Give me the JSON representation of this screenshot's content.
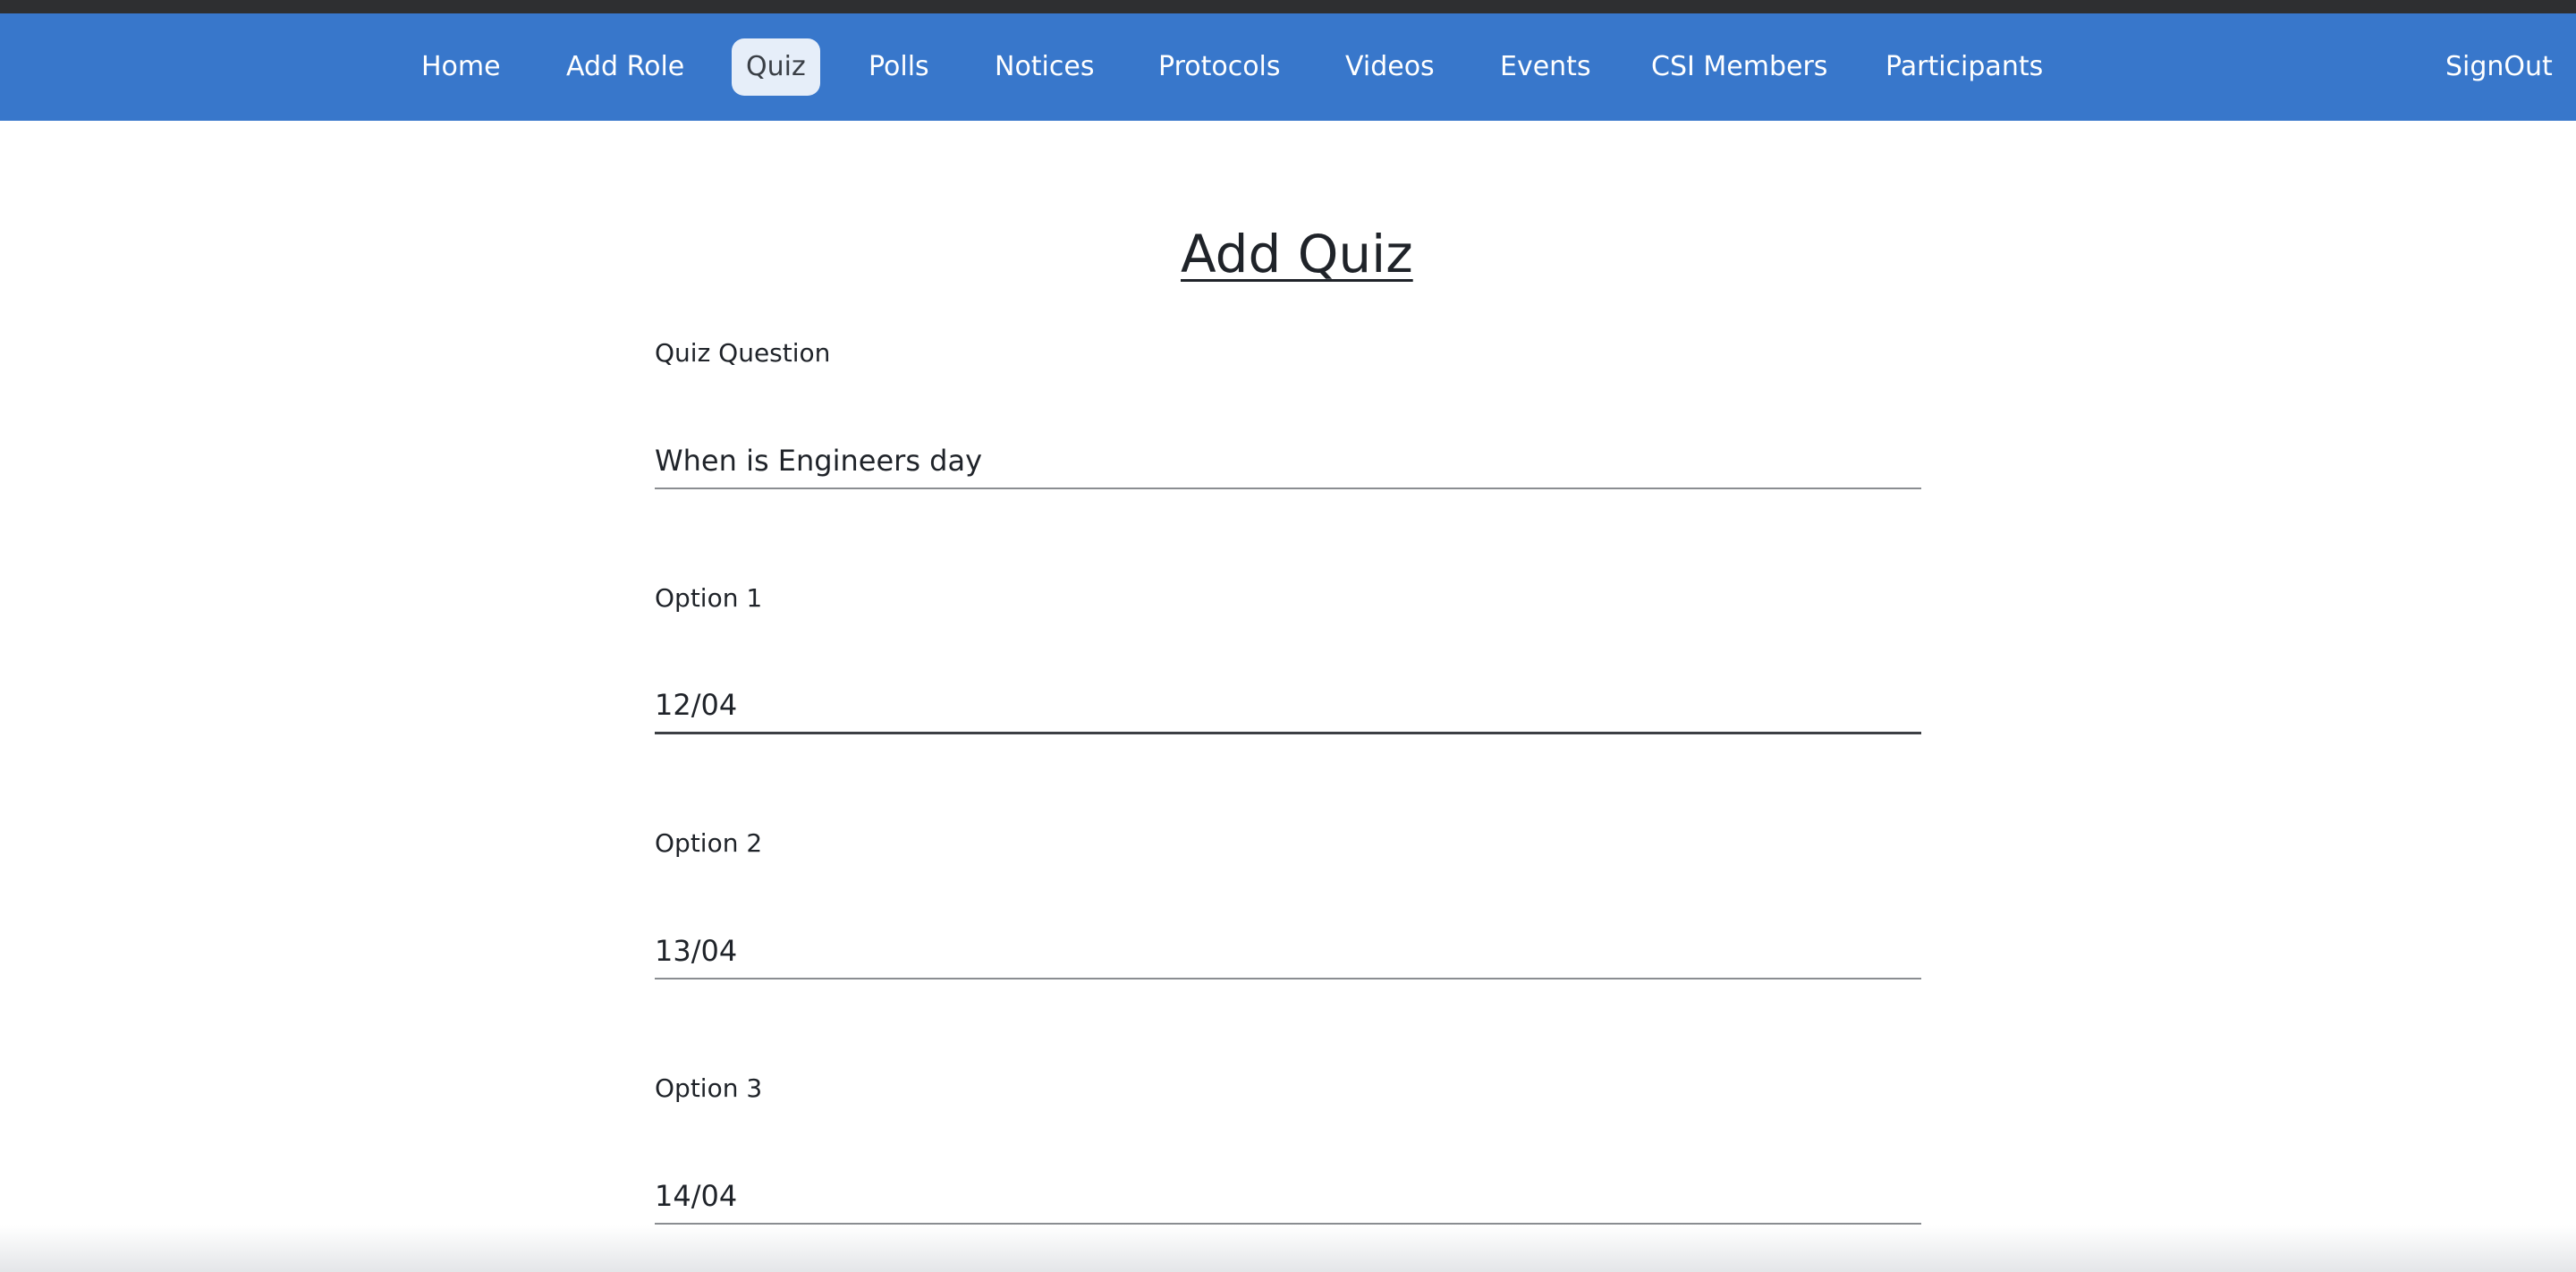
{
  "nav": {
    "items": [
      {
        "label": "Home"
      },
      {
        "label": "Add Role"
      },
      {
        "label": "Quiz",
        "active": true
      },
      {
        "label": "Polls"
      },
      {
        "label": "Notices"
      },
      {
        "label": "Protocols"
      },
      {
        "label": "Videos"
      },
      {
        "label": "Events"
      },
      {
        "label": "CSI Members"
      },
      {
        "label": "Participants"
      }
    ],
    "signout_label": "SignOut"
  },
  "form": {
    "title": "Add Quiz",
    "question": {
      "label": "Quiz Question",
      "value": "When is Engineers day"
    },
    "option1": {
      "label": "Option 1",
      "value": "12/04"
    },
    "option2": {
      "label": "Option 2",
      "value": "13/04"
    },
    "option3": {
      "label": "Option 3",
      "value": "14/04"
    }
  },
  "colors": {
    "navbar": "#3877cb",
    "active_tab_bg": "#e6eef9",
    "top_strip": "#2e2f31"
  }
}
